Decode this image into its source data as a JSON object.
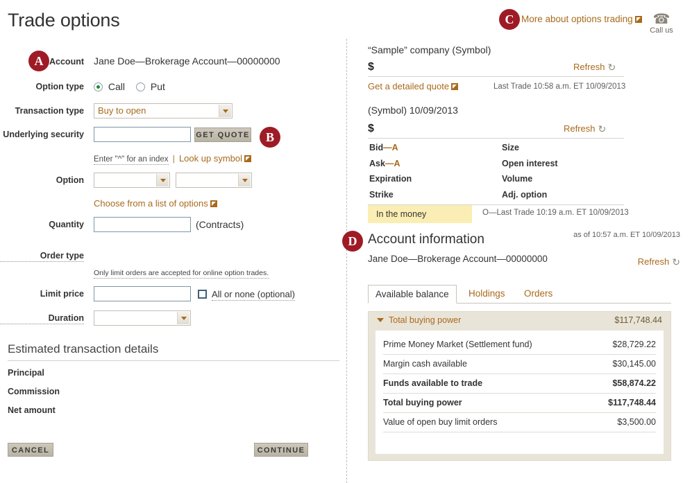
{
  "page": {
    "title": "Trade options"
  },
  "badges": {
    "a": "A",
    "b": "B",
    "c": "C",
    "d": "D"
  },
  "form": {
    "account_label": "Account",
    "account_value": "Jane Doe—Brokerage Account—00000000",
    "option_type_label": "Option type",
    "option_type_call": "Call",
    "option_type_put": "Put",
    "transaction_type_label": "Transaction type",
    "transaction_type_value": "Buy to open",
    "underlying_label": "Underlying security",
    "underlying_value": "",
    "get_quote_button": "GET QUOTE",
    "index_hint": "Enter \"^\" for an index",
    "hint_separator": "|",
    "lookup_symbol_link": "Look up symbol",
    "option_label": "Option",
    "option_month_value": "",
    "option_strike_value": "",
    "choose_list_link": "Choose from a list of options",
    "quantity_label": "Quantity",
    "quantity_value": "",
    "contracts_suffix": "(Contracts)",
    "order_type_label": "Order type",
    "order_type_note": "Only limit orders are accepted for online option trades.",
    "limit_price_label": "Limit price",
    "limit_price_value": "",
    "all_or_none_label": "All or none (optional)",
    "duration_label": "Duration",
    "duration_value": ""
  },
  "estimated": {
    "title": "Estimated transaction details",
    "rows": [
      "Principal",
      "Commission",
      "Net amount"
    ]
  },
  "actions": {
    "cancel": "CANCEL",
    "continue": "CONTINUE"
  },
  "topright": {
    "more_link": "More about options trading",
    "call_us": "Call us",
    "phone_icon": "phone-icon"
  },
  "quote_stock": {
    "title": "“Sample” company (Symbol)",
    "dollar": "$",
    "refresh": "Refresh",
    "detailed_quote_link": "Get a detailed quote",
    "last_trade": "Last Trade 10:58 a.m. ET 10/09/2013"
  },
  "quote_option": {
    "title": "(Symbol) 10/09/2013",
    "dollar": "$",
    "refresh": "Refresh",
    "left_fields": [
      {
        "label": "Bid",
        "sup": "—A"
      },
      {
        "label": "Ask",
        "sup": "—A"
      },
      {
        "label": "Expiration",
        "sup": ""
      },
      {
        "label": "Strike",
        "sup": ""
      }
    ],
    "right_fields": [
      {
        "label": "Size",
        "sup": ""
      },
      {
        "label": "Open interest",
        "sup": ""
      },
      {
        "label": "Volume",
        "sup": ""
      },
      {
        "label": "Adj. option",
        "sup": ""
      }
    ],
    "in_the_money": "In the money",
    "option_last_trade": "O—Last Trade 10:19 a.m. ET 10/09/2013"
  },
  "account_info": {
    "heading": "Account information",
    "as_of": "as of 10:57 a.m. ET 10/09/2013",
    "account_name": "Jane Doe—Brokerage Account—00000000",
    "refresh": "Refresh",
    "tabs": [
      {
        "label": "Available balance",
        "active": true
      },
      {
        "label": "Holdings",
        "active": false
      },
      {
        "label": "Orders",
        "active": false
      }
    ],
    "panel_header_label": "Total buying power",
    "panel_header_value": "$117,748.44",
    "rows": [
      {
        "label": "Prime Money Market (Settlement fund)",
        "value": "$28,729.22",
        "bold": false
      },
      {
        "label": "Margin cash available",
        "value": "$30,145.00",
        "bold": false
      },
      {
        "label": "Funds available to trade",
        "value": "$58,874.22",
        "bold": true
      },
      {
        "label": "Total buying power",
        "value": "$117,748.44",
        "bold": true
      },
      {
        "label": "Value of open buy limit orders",
        "value": "$3,500.00",
        "bold": false
      }
    ]
  },
  "colors": {
    "badge_red": "#9e1b26",
    "link_gold": "#a86a1c",
    "panel_beige": "#e9e4d8",
    "highlight_yellow": "#faeeb4",
    "input_border": "#7d96a5"
  }
}
